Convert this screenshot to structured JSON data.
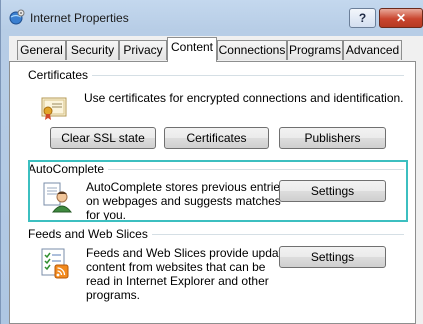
{
  "window": {
    "title": "Internet Properties",
    "help_label": "?",
    "close_label": "✕"
  },
  "tabs": [
    {
      "label": "General"
    },
    {
      "label": "Security"
    },
    {
      "label": "Privacy"
    },
    {
      "label": "Content",
      "active": true
    },
    {
      "label": "Connections"
    },
    {
      "label": "Programs"
    },
    {
      "label": "Advanced"
    }
  ],
  "certificates": {
    "heading": "Certificates",
    "description": "Use certificates for encrypted connections and identification.",
    "clear_ssl_label": "Clear SSL state",
    "certificates_label": "Certificates",
    "publishers_label": "Publishers"
  },
  "autocomplete": {
    "heading": "AutoComplete",
    "description_lines": [
      "AutoComplete stores previous entries",
      "on webpages and suggests matches",
      "for you."
    ],
    "settings_label": "Settings"
  },
  "feeds": {
    "heading": "Feeds and Web Slices",
    "description_lines": [
      "Feeds and Web Slices provide updated",
      "content from websites that can be",
      "read in Internet Explorer and other",
      "programs."
    ],
    "settings_label": "Settings"
  },
  "colors": {
    "highlight": "#3cbfc0",
    "close_button": "#c9452e"
  }
}
